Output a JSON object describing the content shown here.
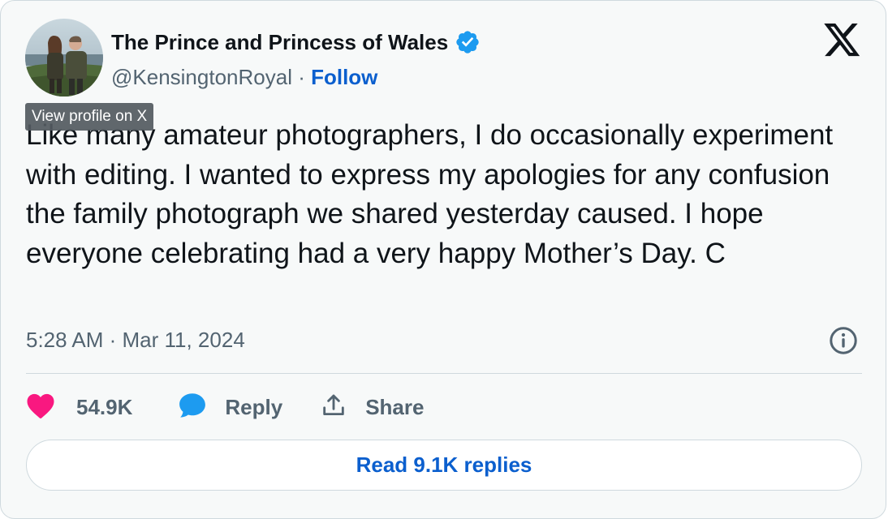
{
  "author": {
    "display_name": "The Prince and Princess of Wales",
    "handle": "@KensingtonRoyal",
    "separator": " · ",
    "follow_label": "Follow",
    "verified": true,
    "verified_color": "#1d9bf0"
  },
  "tooltip": {
    "text": "View profile on X"
  },
  "tweet": {
    "text": "Like many amateur photographers, I do occasionally experiment with editing. I wanted to express my apologies for any confusion the family photograph we shared yesterday caused. I hope everyone celebrating had a very happy Mother’s Day. C",
    "timestamp": "5:28 AM · Mar 11, 2024"
  },
  "actions": {
    "like_count": "54.9K",
    "reply_label": "Reply",
    "share_label": "Share",
    "read_replies_label": "Read 9.1K replies"
  },
  "icons": {
    "brand": "x-logo-icon",
    "info": "info-icon",
    "like": "heart-icon",
    "reply": "speech-bubble-icon",
    "share": "share-icon",
    "verified": "verified-badge-icon"
  },
  "colors": {
    "like": "#f91880",
    "reply": "#1d9bf0",
    "link": "#0b5fce",
    "muted": "#536471",
    "text": "#0f1419",
    "background": "#f7f9f9"
  }
}
